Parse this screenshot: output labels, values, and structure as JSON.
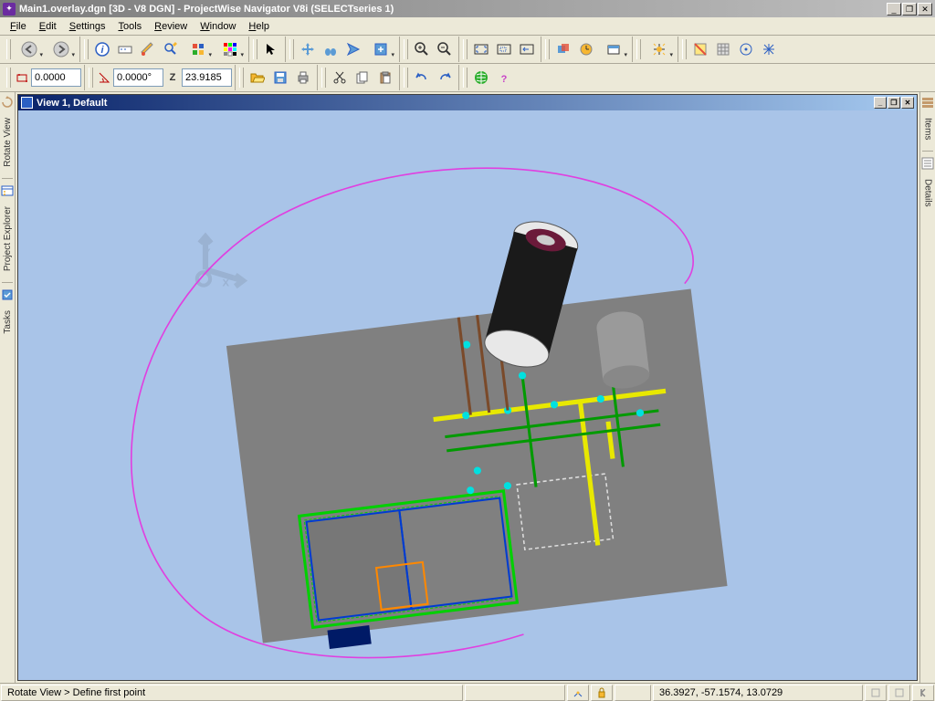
{
  "title": "Main1.overlay.dgn [3D - V8 DGN] - ProjectWise Navigator V8i (SELECTseries 1)",
  "menu": [
    "File",
    "Edit",
    "Settings",
    "Tools",
    "Review",
    "Window",
    "Help"
  ],
  "toolbar2": {
    "dist": "0.0000",
    "angle": "0.0000°",
    "z_label": "Z",
    "z": "23.9185"
  },
  "view": {
    "title": "View 1, Default"
  },
  "sidebar_left": {
    "items": [
      "Rotate View",
      "Project Explorer",
      "Tasks"
    ]
  },
  "sidebar_right": {
    "items": [
      "Items",
      "Details"
    ]
  },
  "status": {
    "prompt": "Rotate View > Define first point",
    "coords": "36.3927, -57.1574, 13.0729"
  },
  "colors": {
    "viewport": "#a9c4e8",
    "ground": "#808080",
    "annotation": "#e040e0"
  }
}
